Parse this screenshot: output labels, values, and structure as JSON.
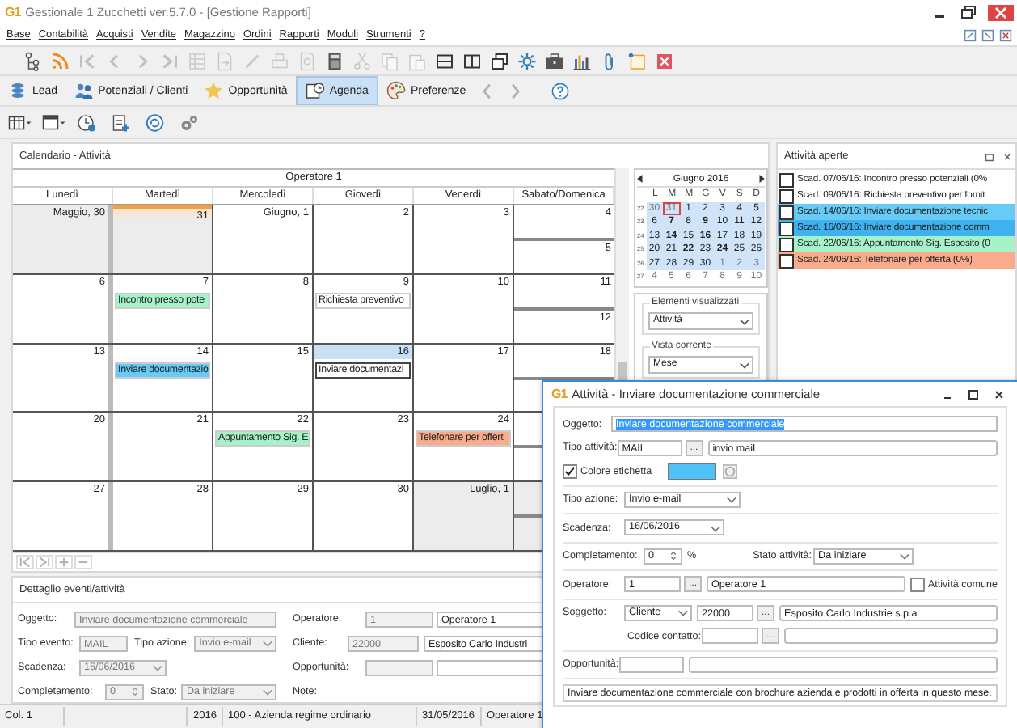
{
  "window": {
    "logo": "G1",
    "title": "Gestionale 1 Zucchetti ver.5.7.0 - [Gestione Rapporti]"
  },
  "menu": [
    "Base",
    "Contabilità",
    "Acquisti",
    "Vendite",
    "Magazzino",
    "Ordini",
    "Rapporti",
    "Moduli",
    "Strumenti",
    "?"
  ],
  "toolbar": [
    {
      "kind": "tree",
      "disabled": false
    },
    {
      "kind": "rss",
      "disabled": false
    },
    {
      "kind": "first",
      "disabled": true
    },
    {
      "kind": "prev",
      "disabled": true
    },
    {
      "kind": "next",
      "disabled": true
    },
    {
      "kind": "last",
      "disabled": true
    },
    {
      "kind": "griddoc",
      "disabled": true
    },
    {
      "kind": "docarrow",
      "disabled": true
    },
    {
      "kind": "pen",
      "disabled": true
    },
    {
      "kind": "printer",
      "disabled": true
    },
    {
      "kind": "preview",
      "disabled": true
    },
    {
      "kind": "calculator",
      "disabled": false
    },
    {
      "kind": "scissors",
      "disabled": true
    },
    {
      "kind": "copy",
      "disabled": true
    },
    {
      "kind": "paste",
      "disabled": true
    },
    {
      "kind": "splith",
      "disabled": false
    },
    {
      "kind": "splitv",
      "disabled": false
    },
    {
      "kind": "windows",
      "disabled": false
    },
    {
      "kind": "gear",
      "disabled": false
    },
    {
      "kind": "briefcase",
      "disabled": false
    },
    {
      "kind": "chart",
      "disabled": false
    },
    {
      "kind": "clip",
      "disabled": false
    },
    {
      "kind": "note",
      "disabled": false
    },
    {
      "kind": "close",
      "disabled": false
    }
  ],
  "tabs": [
    {
      "label": "Lead",
      "kind": "lead",
      "selected": false
    },
    {
      "label": "Potenziali / Clienti",
      "kind": "clients",
      "selected": false
    },
    {
      "label": "Opportunità",
      "kind": "star",
      "selected": false
    },
    {
      "label": "Agenda",
      "kind": "agenda",
      "selected": true
    },
    {
      "label": "Preferenze",
      "kind": "palette",
      "selected": false
    }
  ],
  "tab_nav": [
    {
      "kind": "back",
      "disabled": true
    },
    {
      "kind": "forward",
      "disabled": true
    },
    {
      "kind": "help",
      "disabled": false
    }
  ],
  "subtoolbar": [
    {
      "kind": "tablemenu"
    },
    {
      "kind": "windowmenu"
    },
    {
      "kind": "clockadd"
    },
    {
      "kind": "clipboardadd"
    },
    {
      "kind": "sync"
    },
    {
      "kind": "gears"
    }
  ],
  "calendar": {
    "title": "Calendario - Attività",
    "operator": "Operatore 1",
    "weekdays": [
      "Lunedì",
      "Martedì",
      "Mercoledì",
      "Giovedì",
      "Venerdì",
      "Sabato/Domenica"
    ],
    "weeks": [
      {
        "days": [
          {
            "n": "Maggio, 30",
            "shaded": true,
            "today": false,
            "selected": false
          },
          {
            "n": "31",
            "shaded": true,
            "today": true,
            "selected": false
          },
          {
            "n": "Giugno, 1",
            "shaded": false,
            "today": false,
            "selected": false
          },
          {
            "n": "2",
            "shaded": false,
            "today": false,
            "selected": false
          },
          {
            "n": "3",
            "shaded": false,
            "today": false,
            "selected": false
          }
        ],
        "weekend": [
          {
            "n": "4",
            "shaded": false
          },
          {
            "n": "5",
            "shaded": false
          }
        ]
      },
      {
        "days": [
          {
            "n": "6",
            "shaded": false,
            "today": false,
            "selected": false
          },
          {
            "n": "7",
            "shaded": false,
            "today": false,
            "selected": false,
            "event": {
              "text": "Incontro presso pote",
              "color": "#a6f2c8"
            }
          },
          {
            "n": "8",
            "shaded": false,
            "today": false,
            "selected": false
          },
          {
            "n": "9",
            "shaded": false,
            "today": false,
            "selected": false,
            "event": {
              "text": "Richiesta preventivo",
              "color": "#ffffff"
            }
          },
          {
            "n": "10",
            "shaded": false,
            "today": false,
            "selected": false
          }
        ],
        "weekend": [
          {
            "n": "11",
            "shaded": false
          },
          {
            "n": "12",
            "shaded": false
          }
        ]
      },
      {
        "days": [
          {
            "n": "13",
            "shaded": false,
            "today": false,
            "selected": false
          },
          {
            "n": "14",
            "shaded": false,
            "today": false,
            "selected": false,
            "event": {
              "text": "Inviare documentazio",
              "color": "#66ccf7"
            }
          },
          {
            "n": "15",
            "shaded": false,
            "today": false,
            "selected": false
          },
          {
            "n": "16",
            "shaded": false,
            "today": false,
            "selected": true,
            "event": {
              "text": "Inviare documentazi",
              "color": "#ffffff"
            }
          },
          {
            "n": "17",
            "shaded": false,
            "today": false,
            "selected": false
          }
        ],
        "weekend": [
          {
            "n": "18",
            "shaded": false
          },
          {
            "shaded": false
          }
        ]
      },
      {
        "days": [
          {
            "n": "20",
            "shaded": false,
            "today": false,
            "selected": false
          },
          {
            "n": "21",
            "shaded": false,
            "today": false,
            "selected": false
          },
          {
            "n": "22",
            "shaded": false,
            "today": false,
            "selected": false,
            "event": {
              "text": "Appuntamento Sig. E",
              "color": "#a6f2c8"
            }
          },
          {
            "n": "23",
            "shaded": false,
            "today": false,
            "selected": false
          },
          {
            "n": "24",
            "shaded": false,
            "today": false,
            "selected": false,
            "event": {
              "text": "Telefonare per offert",
              "color": "#f9ab8c"
            }
          }
        ],
        "weekend": [
          {
            "shaded": false
          },
          {
            "shaded": false
          }
        ]
      },
      {
        "days": [
          {
            "n": "27",
            "shaded": false,
            "today": false,
            "selected": false
          },
          {
            "n": "28",
            "shaded": false,
            "today": false,
            "selected": false
          },
          {
            "n": "29",
            "shaded": false,
            "today": false,
            "selected": false
          },
          {
            "n": "30",
            "shaded": false,
            "today": false,
            "selected": false
          },
          {
            "n": "Luglio, 1",
            "shaded": true,
            "today": false,
            "selected": false
          }
        ],
        "weekend": [
          {
            "shaded": true
          },
          {
            "shaded": true
          }
        ]
      }
    ]
  },
  "mini_calendar": {
    "month": "Giugno 2016",
    "weekdays": [
      "L",
      "M",
      "M",
      "G",
      "V",
      "S",
      "D"
    ],
    "weeks": [
      {
        "num": "22",
        "selected": true,
        "days": [
          {
            "d": "30",
            "other": true,
            "bold": false,
            "today": false
          },
          {
            "d": "31",
            "other": true,
            "bold": false,
            "today": true
          },
          {
            "d": "1",
            "other": false,
            "bold": false,
            "today": false
          },
          {
            "d": "2",
            "other": false,
            "bold": false,
            "today": false
          },
          {
            "d": "3",
            "other": false,
            "bold": false,
            "today": false
          },
          {
            "d": "4",
            "other": false,
            "bold": false,
            "today": false
          },
          {
            "d": "5",
            "other": false,
            "bold": false,
            "today": false
          }
        ]
      },
      {
        "num": "23",
        "selected": true,
        "days": [
          {
            "d": "6",
            "other": false,
            "bold": false,
            "today": false
          },
          {
            "d": "7",
            "other": false,
            "bold": true,
            "today": false
          },
          {
            "d": "8",
            "other": false,
            "bold": false,
            "today": false
          },
          {
            "d": "9",
            "other": false,
            "bold": true,
            "today": false
          },
          {
            "d": "10",
            "other": false,
            "bold": false,
            "today": false
          },
          {
            "d": "11",
            "other": false,
            "bold": false,
            "today": false
          },
          {
            "d": "12",
            "other": false,
            "bold": false,
            "today": false
          }
        ]
      },
      {
        "num": "24",
        "selected": true,
        "days": [
          {
            "d": "13",
            "other": false,
            "bold": false,
            "today": false
          },
          {
            "d": "14",
            "other": false,
            "bold": true,
            "today": false
          },
          {
            "d": "15",
            "other": false,
            "bold": false,
            "today": false
          },
          {
            "d": "16",
            "other": false,
            "bold": true,
            "today": false
          },
          {
            "d": "17",
            "other": false,
            "bold": false,
            "today": false
          },
          {
            "d": "18",
            "other": false,
            "bold": false,
            "today": false
          },
          {
            "d": "19",
            "other": false,
            "bold": false,
            "today": false
          }
        ]
      },
      {
        "num": "25",
        "selected": true,
        "days": [
          {
            "d": "20",
            "other": false,
            "bold": false,
            "today": false
          },
          {
            "d": "21",
            "other": false,
            "bold": false,
            "today": false
          },
          {
            "d": "22",
            "other": false,
            "bold": true,
            "today": false
          },
          {
            "d": "23",
            "other": false,
            "bold": false,
            "today": false
          },
          {
            "d": "24",
            "other": false,
            "bold": true,
            "today": false
          },
          {
            "d": "25",
            "other": false,
            "bold": false,
            "today": false
          },
          {
            "d": "26",
            "other": false,
            "bold": false,
            "today": false
          }
        ]
      },
      {
        "num": "26",
        "selected": true,
        "days": [
          {
            "d": "27",
            "other": false,
            "bold": false,
            "today": false
          },
          {
            "d": "28",
            "other": false,
            "bold": false,
            "today": false
          },
          {
            "d": "29",
            "other": false,
            "bold": false,
            "today": false
          },
          {
            "d": "30",
            "other": false,
            "bold": false,
            "today": false
          },
          {
            "d": "1",
            "other": true,
            "bold": false,
            "today": false
          },
          {
            "d": "2",
            "other": true,
            "bold": false,
            "today": false
          },
          {
            "d": "3",
            "other": true,
            "bold": false,
            "today": false
          }
        ]
      },
      {
        "num": "27",
        "selected": false,
        "days": [
          {
            "d": "4",
            "other": true,
            "bold": false,
            "today": false
          },
          {
            "d": "5",
            "other": true,
            "bold": false,
            "today": false
          },
          {
            "d": "6",
            "other": true,
            "bold": false,
            "today": false
          },
          {
            "d": "7",
            "other": true,
            "bold": false,
            "today": false
          },
          {
            "d": "8",
            "other": true,
            "bold": false,
            "today": false
          },
          {
            "d": "9",
            "other": true,
            "bold": false,
            "today": false
          },
          {
            "d": "10",
            "other": true,
            "bold": false,
            "today": false
          }
        ]
      }
    ]
  },
  "filters": [
    {
      "legend": "Elementi visualizzati",
      "value": "Attività"
    },
    {
      "legend": "Vista corrente",
      "value": "Mese"
    }
  ],
  "detail": {
    "title": "Dettaglio eventi/attività",
    "disabled": true,
    "subject": {
      "label": "Oggetto:",
      "value": "Inviare documentazione commerciale"
    },
    "event_type": {
      "label": "Tipo evento:",
      "value": "MAIL"
    },
    "action_type": {
      "label": "Tipo azione:",
      "value": "Invio e-mail"
    },
    "due": {
      "label": "Scadenza:",
      "value": "16/06/2016"
    },
    "completion": {
      "label": "Completamento:",
      "value": "0"
    },
    "state": {
      "label": "Stato:",
      "value": "Da iniziare"
    },
    "operator": {
      "label": "Operatore:",
      "code": "1",
      "name": "Operatore 1"
    },
    "customer": {
      "label": "Cliente:",
      "code": "22000",
      "name": "Esposito Carlo Industri"
    },
    "opportunity": {
      "label": "Opportunità:"
    },
    "notes": {
      "label": "Note:"
    }
  },
  "open_activities": {
    "title": "Attività aperte",
    "items": [
      {
        "text": "Scad. 07/06/16: Incontro presso potenziali (0%",
        "checked": false,
        "color": "#ffffff"
      },
      {
        "text": "Scad. 09/06/16: Richiesta preventivo per fornit",
        "checked": false,
        "color": "#ffffff"
      },
      {
        "text": "Scad. 14/06/16: Inviare documentazione tecnic",
        "checked": false,
        "color": "#66ccf7"
      },
      {
        "text": "Scad. 16/06/16: Inviare documentazione comm",
        "checked": false,
        "color": "#3db2ee"
      },
      {
        "text": "Scad. 22/06/16: Appuntamento Sig. Esposito (0",
        "checked": false,
        "color": "#a6f2c8"
      },
      {
        "text": "Scad. 24/06/16: Telefonare per offerta (0%)",
        "checked": false,
        "color": "#f9ab8c"
      }
    ]
  },
  "status_bar": [
    "Col. 1",
    "2016",
    "100 - Azienda regime ordinario",
    "31/05/2016",
    "Operatore 1"
  ],
  "dialog": {
    "logo": "G1",
    "title": "Attività - Inviare documentazione commerciale",
    "subject": {
      "label": "Oggetto:",
      "value": "Inviare documentazione commerciale"
    },
    "activity_type": {
      "label": "Tipo attività:",
      "code": "MAIL",
      "browse": "...",
      "name": "invio mail"
    },
    "label_color": {
      "label": "Colore etichetta",
      "checked": true,
      "color": "#4fc3f7"
    },
    "action_type": {
      "label": "Tipo azione:",
      "value": "Invio e-mail"
    },
    "due": {
      "label": "Scadenza:",
      "value": "16/06/2016"
    },
    "completion": {
      "label": "Completamento:",
      "value": "0",
      "unit": "%"
    },
    "state": {
      "label": "Stato attività:",
      "value": "Da iniziare"
    },
    "operator": {
      "label": "Operatore:",
      "code": "1",
      "browse": "...",
      "name": "Operatore 1"
    },
    "shared": {
      "label": "Attività comune",
      "checked": false
    },
    "party": {
      "label": "Soggetto:",
      "type": "Cliente",
      "code": "22000",
      "browse": "...",
      "name": "Esposito Carlo Industrie s.p.a"
    },
    "contact": {
      "label": "Codice contatto:",
      "browse": "..."
    },
    "opportunity": {
      "label": "Opportunità:"
    },
    "notes": "Inviare documentazione commerciale con brochure azienda e prodotti in offerta in questo mese."
  }
}
